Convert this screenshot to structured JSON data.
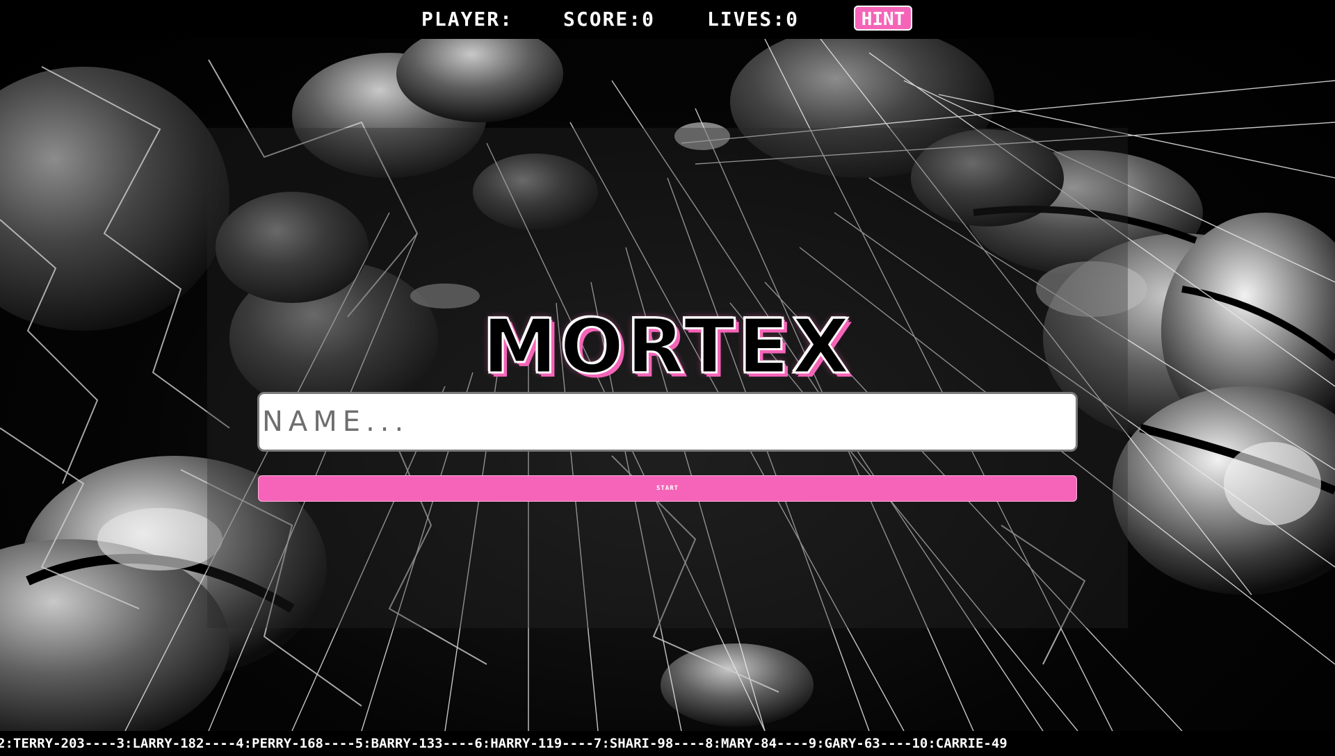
{
  "hud": {
    "player_label": "PLAYER:",
    "score_label": "SCORE:0",
    "lives_label": "LIVES:0",
    "hint_label": "HINT"
  },
  "title": "MORTEX",
  "name_input": {
    "placeholder": "NAME...",
    "value": ""
  },
  "start_button": {
    "label": "START"
  },
  "leaderboard_ticker": "2:TERRY-203----3:LARRY-182----4:PERRY-168----5:BARRY-133----6:HARRY-119----7:SHARI-98----8:MARY-84----9:GARY-63----10:CARRIE-49",
  "colors": {
    "accent": "#f564b8",
    "background": "#000000",
    "text": "#ffffff"
  }
}
